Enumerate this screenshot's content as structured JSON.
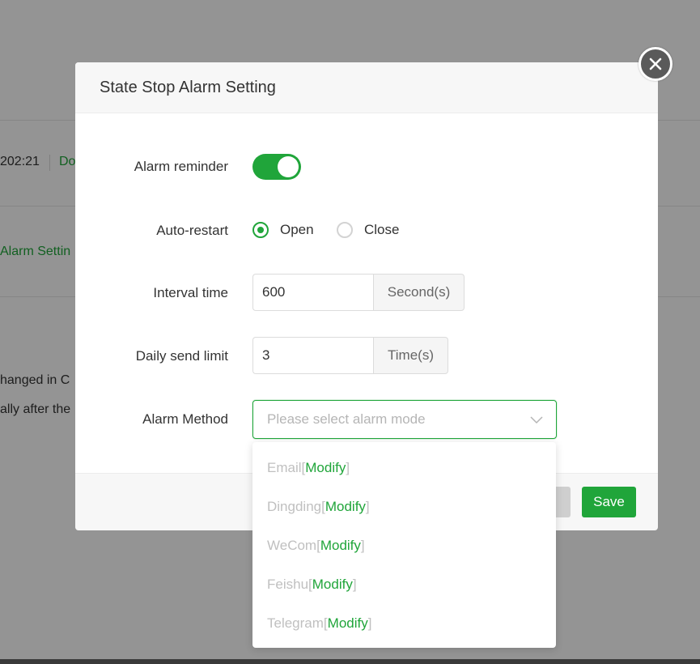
{
  "background": {
    "time_fragment": "202:21",
    "link_fragment": "Do",
    "alarm_setting_fragment": "Alarm Settin",
    "text_line_1": "hanged in C",
    "text_line_2": "ally after the"
  },
  "modal": {
    "title": "State Stop Alarm Setting",
    "close_icon": "close-icon",
    "alarm_reminder": {
      "label": "Alarm reminder",
      "enabled": true
    },
    "auto_restart": {
      "label": "Auto-restart",
      "options": [
        {
          "label": "Open",
          "checked": true
        },
        {
          "label": "Close",
          "checked": false
        }
      ]
    },
    "interval_time": {
      "label": "Interval time",
      "value": "600",
      "unit": "Second(s)"
    },
    "daily_send_limit": {
      "label": "Daily send limit",
      "value": "3",
      "unit": "Time(s)"
    },
    "alarm_method": {
      "label": "Alarm Method",
      "placeholder": "Please select alarm mode",
      "options": [
        {
          "name": "Email",
          "action": "Modify"
        },
        {
          "name": "Dingding",
          "action": "Modify"
        },
        {
          "name": "WeCom",
          "action": "Modify"
        },
        {
          "name": "Feishu",
          "action": "Modify"
        },
        {
          "name": "Telegram",
          "action": "Modify"
        }
      ]
    },
    "footer": {
      "save_label": "Save"
    }
  },
  "colors": {
    "accent": "#20a53a",
    "overlay": "rgba(0,0,0,0.42)"
  }
}
